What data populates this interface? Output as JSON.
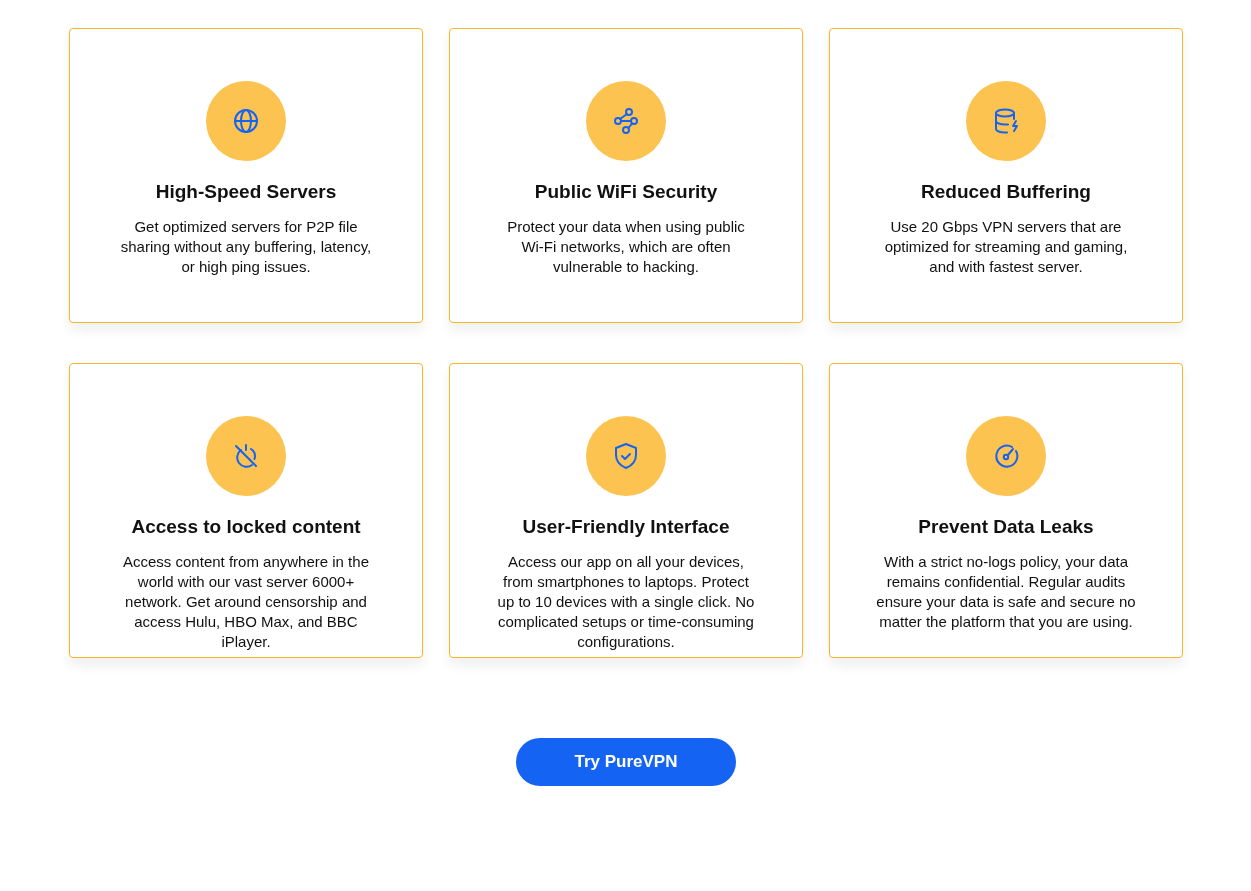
{
  "features": [
    {
      "kind": "globe",
      "title": "High-Speed Servers",
      "text": "Get optimized servers for P2P file sharing without any buffering, latency, or high ping issues."
    },
    {
      "kind": "nodes",
      "title": "Public WiFi Security",
      "text": "Protect your data when using public Wi-Fi networks, which are often vulnerable to hacking."
    },
    {
      "kind": "database",
      "title": "Reduced Buffering",
      "text": "Use 20 Gbps VPN servers that are optimized for streaming and gaming, and with fastest server."
    },
    {
      "kind": "power-off",
      "title": "Access to locked content",
      "text": "Access content from anywhere in the world with our vast server 6000+ network. Get around censorship and access Hulu, HBO Max, and BBC iPlayer."
    },
    {
      "kind": "shield",
      "title": "User-Friendly Interface",
      "text": "Access our app on all your devices, from smartphones to laptops. Protect up to 10 devices with a single click. No complicated setups or time-consuming configurations."
    },
    {
      "kind": "gauge",
      "title": "Prevent Data Leaks",
      "text": "With a strict no-logs policy, your data remains confidential. Regular audits ensure your data is safe and secure no matter the platform that you are using."
    }
  ],
  "cta": {
    "label": "Try PureVPN"
  }
}
